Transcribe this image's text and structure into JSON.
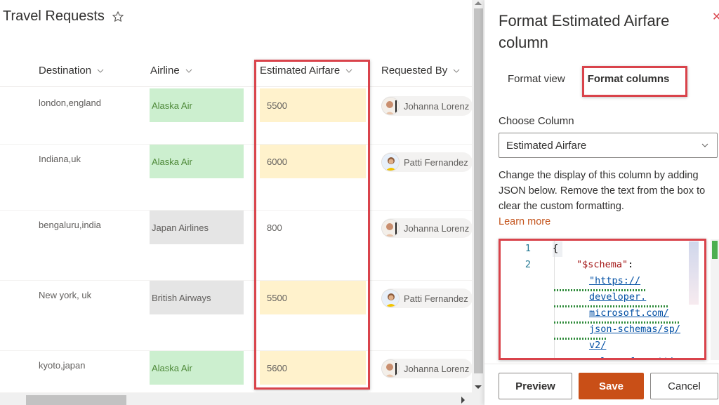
{
  "list": {
    "title": "Travel Requests",
    "columns": [
      {
        "label": "Destination"
      },
      {
        "label": "Airline"
      },
      {
        "label": "Estimated Airfare"
      },
      {
        "label": "Requested By"
      }
    ],
    "rows": [
      {
        "destination": "london,england",
        "airline": "Alaska Air",
        "airline_style": "green",
        "fare": "5500",
        "fare_highlight": true,
        "requested_by": "Johanna Lorenz",
        "avatar": "johanna"
      },
      {
        "destination": "Indiana,uk",
        "airline": "Alaska Air",
        "airline_style": "green",
        "fare": "6000",
        "fare_highlight": true,
        "requested_by": "Patti Fernandez",
        "avatar": "patti"
      },
      {
        "destination": "bengaluru,india",
        "airline": "Japan Airlines",
        "airline_style": "gray",
        "fare": "800",
        "fare_highlight": false,
        "requested_by": "Johanna Lorenz",
        "avatar": "johanna"
      },
      {
        "destination": "New york, uk",
        "airline": "British Airways",
        "airline_style": "gray",
        "fare": "5500",
        "fare_highlight": true,
        "requested_by": "Patti Fernandez",
        "avatar": "patti"
      },
      {
        "destination": "kyoto,japan",
        "airline": "Alaska Air",
        "airline_style": "green",
        "fare": "5600",
        "fare_highlight": true,
        "requested_by": "Johanna Lorenz",
        "avatar": "johanna"
      }
    ]
  },
  "panel": {
    "title": "Format Estimated Airfare column",
    "tabs": [
      {
        "label": "Format view",
        "active": false
      },
      {
        "label": "Format columns",
        "active": true
      }
    ],
    "choose_column_label": "Choose Column",
    "selected_column": "Estimated Airfare",
    "description": "Change the display of this column by adding JSON below. Remove the text from the box to clear the custom formatting.",
    "learn_more": "Learn more",
    "editor": {
      "line_numbers": [
        "1",
        "2"
      ],
      "line1": "{",
      "key": "\"$schema\"",
      "colon": ":",
      "url_lines": [
        "\"https://",
        "developer.",
        "microsoft.com/",
        "json-schemas/sp/",
        "v2/",
        "column-formattin"
      ]
    },
    "buttons": {
      "preview": "Preview",
      "save": "Save",
      "cancel": "Cancel"
    }
  },
  "colors": {
    "green_bg": "#ccefcf",
    "green_text": "#4f8a3a",
    "gray_bg": "#e5e5e5",
    "gray_text": "#605e5c",
    "yellow_bg": "#fff2cc",
    "highlight_red": "#d9434b",
    "save_orange": "#c94f17",
    "link": "#c4541c"
  }
}
